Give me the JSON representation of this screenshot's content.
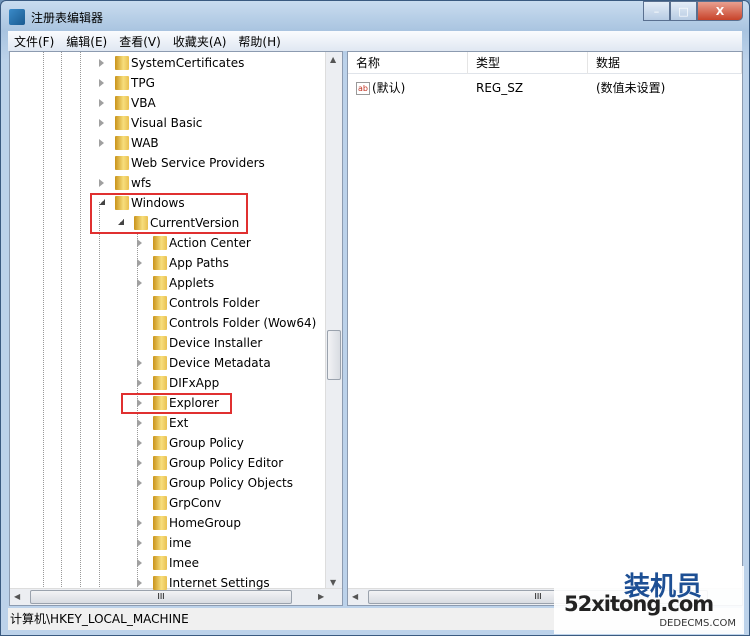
{
  "window": {
    "title": "注册表编辑器",
    "minimize": "–",
    "maximize": "□",
    "close": "X"
  },
  "menu": [
    "文件(F)",
    "编辑(E)",
    "查看(V)",
    "收藏夹(A)",
    "帮助(H)"
  ],
  "tree": [
    {
      "label": "SystemCertificates",
      "level": 1,
      "expander": "collapsed"
    },
    {
      "label": "TPG",
      "level": 1,
      "expander": "collapsed"
    },
    {
      "label": "VBA",
      "level": 1,
      "expander": "collapsed"
    },
    {
      "label": "Visual Basic",
      "level": 1,
      "expander": "collapsed"
    },
    {
      "label": "WAB",
      "level": 1,
      "expander": "collapsed"
    },
    {
      "label": "Web Service Providers",
      "level": 1,
      "expander": "none"
    },
    {
      "label": "wfs",
      "level": 1,
      "expander": "collapsed"
    },
    {
      "label": "Windows",
      "level": 1,
      "expander": "expanded",
      "highlighted": true
    },
    {
      "label": "CurrentVersion",
      "level": 2,
      "expander": "expanded",
      "highlighted": true
    },
    {
      "label": "Action Center",
      "level": 3,
      "expander": "collapsed"
    },
    {
      "label": "App Paths",
      "level": 3,
      "expander": "collapsed"
    },
    {
      "label": "Applets",
      "level": 3,
      "expander": "collapsed"
    },
    {
      "label": "Controls Folder",
      "level": 3,
      "expander": "none"
    },
    {
      "label": "Controls Folder (Wow64)",
      "level": 3,
      "expander": "none"
    },
    {
      "label": "Device Installer",
      "level": 3,
      "expander": "none"
    },
    {
      "label": "Device Metadata",
      "level": 3,
      "expander": "collapsed"
    },
    {
      "label": "DIFxApp",
      "level": 3,
      "expander": "collapsed"
    },
    {
      "label": "Explorer",
      "level": 3,
      "expander": "collapsed",
      "highlighted": true
    },
    {
      "label": "Ext",
      "level": 3,
      "expander": "collapsed"
    },
    {
      "label": "Group Policy",
      "level": 3,
      "expander": "collapsed"
    },
    {
      "label": "Group Policy Editor",
      "level": 3,
      "expander": "collapsed"
    },
    {
      "label": "Group Policy Objects",
      "level": 3,
      "expander": "collapsed"
    },
    {
      "label": "GrpConv",
      "level": 3,
      "expander": "none"
    },
    {
      "label": "HomeGroup",
      "level": 3,
      "expander": "collapsed"
    },
    {
      "label": "ime",
      "level": 3,
      "expander": "collapsed"
    },
    {
      "label": "Imee",
      "level": 3,
      "expander": "collapsed"
    },
    {
      "label": "Internet Settings",
      "level": 3,
      "expander": "collapsed"
    }
  ],
  "list": {
    "columns": [
      "名称",
      "类型",
      "数据"
    ],
    "rows": [
      {
        "name": "(默认)",
        "type": "REG_SZ",
        "data": "(数值未设置)",
        "icon": "ab"
      }
    ]
  },
  "statusbar": "计算机\\HKEY_LOCAL_MACHINE",
  "watermark": {
    "cn": "装机员",
    "en": "52xitong.com",
    "sub": "DEDECMS.COM"
  },
  "scroll_thumb": "III"
}
